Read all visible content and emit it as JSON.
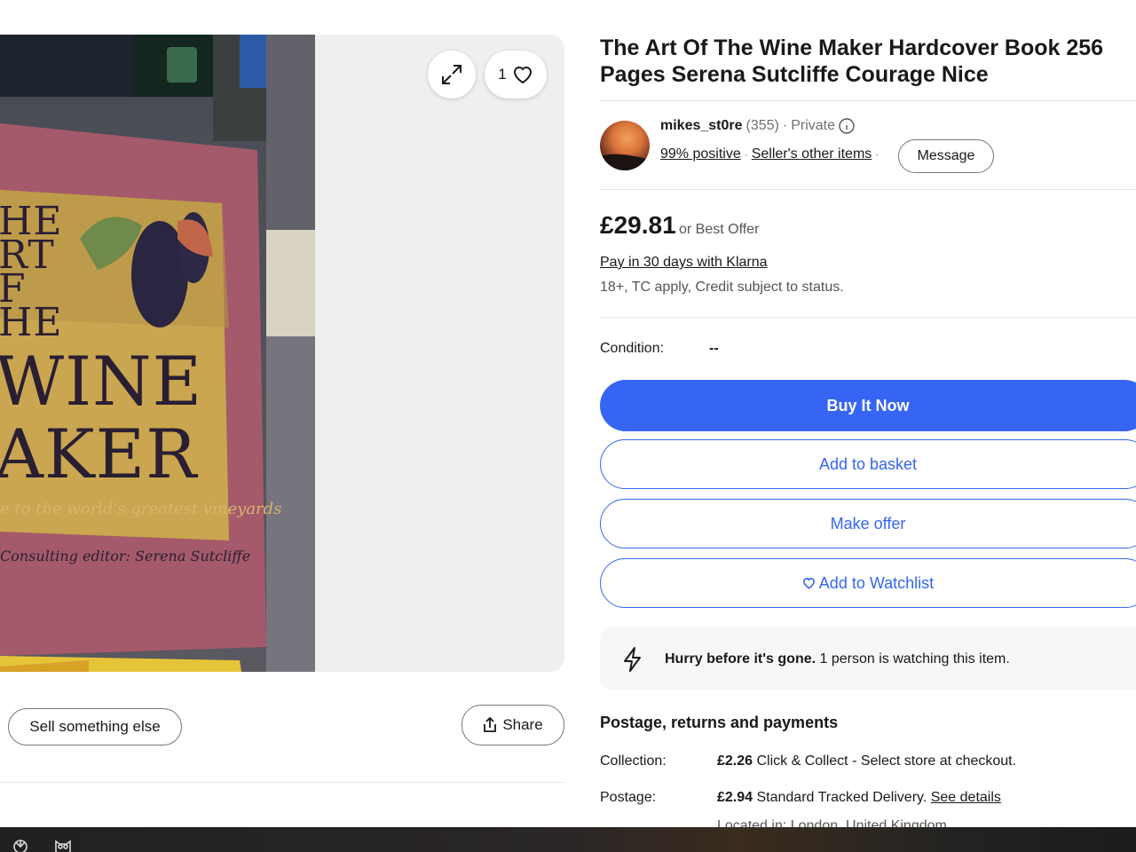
{
  "gallery": {
    "watch_count": "1",
    "book_cover_lines": [
      "HE",
      "RT",
      "F",
      "HE",
      "WINE",
      "AKER"
    ],
    "book_subtitle": "e to the world's greatest vineyards",
    "book_editor": "Consulting editor: Serena Sutcliffe"
  },
  "actions": {
    "sell_label": "Sell something else",
    "share_label": "Share"
  },
  "listing": {
    "title": "The Art Of The Wine Maker Hardcover Book 256 Pages Serena Sutcliffe Courage Nice"
  },
  "seller": {
    "name": "mikes_st0re",
    "feedback_count": "(355)",
    "separator": "·",
    "type": "Private",
    "positive": "99% positive",
    "other_items": "Seller's other items",
    "message_label": "Message"
  },
  "price": {
    "amount": "£29.81",
    "offer_text": "or Best Offer",
    "klarna": "Pay in 30 days with Klarna",
    "klarna_note": "18+, TC apply, Credit subject to status."
  },
  "condition": {
    "label": "Condition:",
    "value": "--"
  },
  "buttons": {
    "buy_now": "Buy It Now",
    "add_basket": "Add to basket",
    "make_offer": "Make offer",
    "watchlist": "Add to Watchlist"
  },
  "hurry": {
    "bold": "Hurry before it's gone.",
    "text": " 1 person is watching this item."
  },
  "postage": {
    "section_title": "Postage, returns and payments",
    "collection_label": "Collection:",
    "collection_price": "£2.26",
    "collection_text": " Click & Collect - Select store at checkout.",
    "postage_label": "Postage:",
    "postage_price": "£2.94",
    "postage_text": " Standard Tracked Delivery. ",
    "see_details": "See details",
    "located": "Located in: London, United Kingdom"
  },
  "colors": {
    "primary_blue": "#3665f3",
    "text": "#191919",
    "muted": "#707070"
  }
}
